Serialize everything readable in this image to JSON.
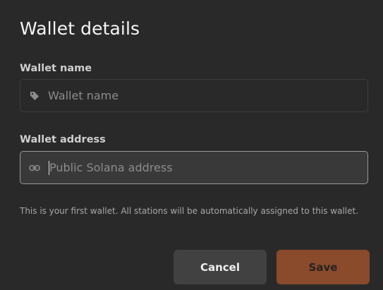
{
  "dialog": {
    "title": "Wallet details",
    "name_field": {
      "label": "Wallet name",
      "placeholder": "Wallet name",
      "value": "",
      "icon": "tag-icon"
    },
    "address_field": {
      "label": "Wallet address",
      "placeholder": "Public Solana address",
      "value": "",
      "icon": "link-icon"
    },
    "helper_text": "This is your first wallet. All stations will be automatically assigned to this wallet.",
    "buttons": {
      "cancel_label": "Cancel",
      "save_label": "Save"
    }
  },
  "colors": {
    "background": "#2a2929",
    "accent": "#8a4a2c",
    "cancel_bg": "#424141"
  }
}
